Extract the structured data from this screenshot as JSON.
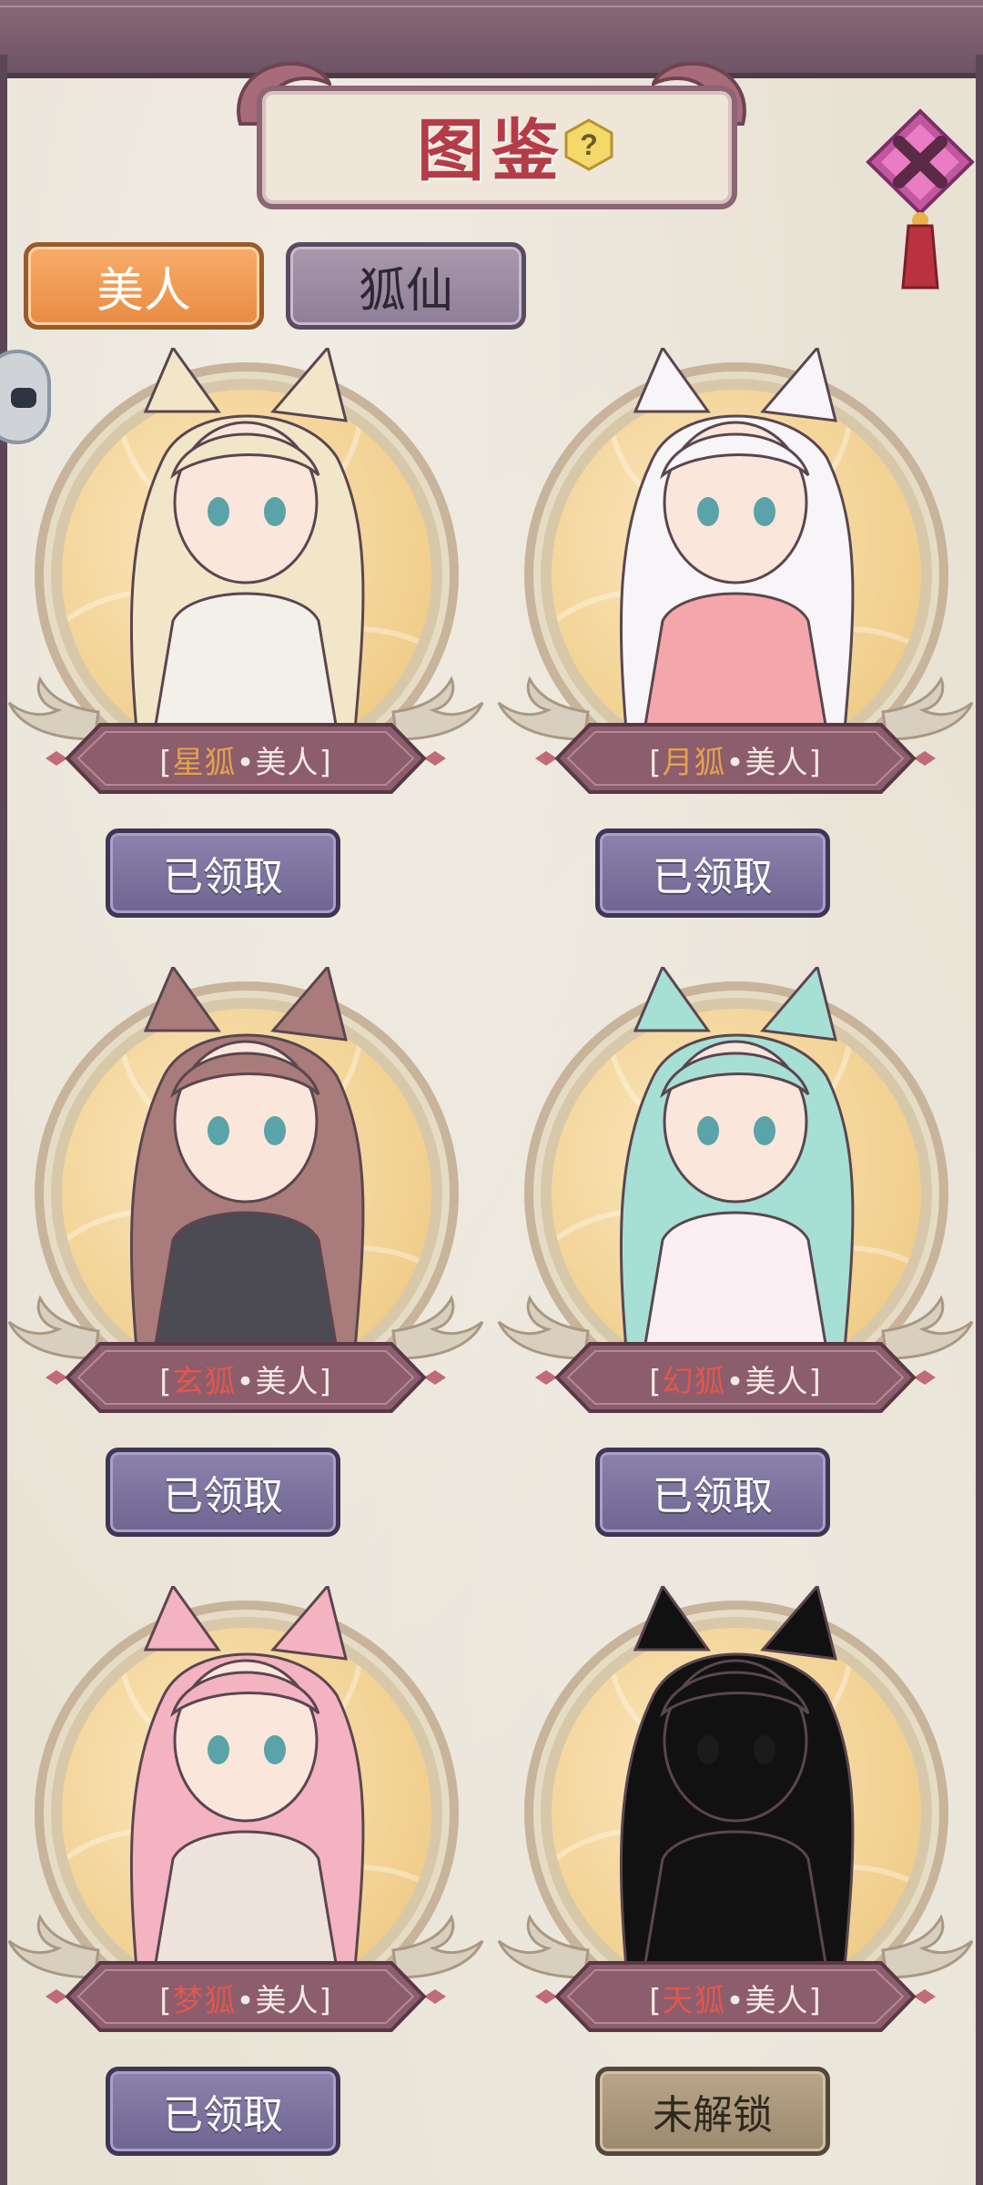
{
  "title": "图鉴",
  "help_icon": "question-mark-icon",
  "close_icon": "knot-close-icon",
  "tabs": [
    {
      "label": "美人",
      "active": true
    },
    {
      "label": "狐仙",
      "active": false
    }
  ],
  "cards": [
    {
      "prefix": "[",
      "fox": "星狐",
      "sep": "•",
      "suffix": "美人]",
      "button": "已领取",
      "state": "claimed",
      "hair": "#f2e6c9",
      "outfit": "#f3f0ea"
    },
    {
      "prefix": "[",
      "fox": "月狐",
      "sep": "•",
      "suffix": "美人]",
      "button": "已领取",
      "state": "claimed",
      "hair": "#f7f5f7",
      "outfit": "#f4a7aa"
    },
    {
      "prefix": "[",
      "fox": "玄狐",
      "sep": "•",
      "suffix": "美人]",
      "button": "已领取",
      "state": "claimed",
      "hair": "#a97c7b",
      "outfit": "#4c4a52"
    },
    {
      "prefix": "[",
      "fox": "幻狐",
      "sep": "•",
      "suffix": "美人]",
      "button": "已领取",
      "state": "claimed",
      "hair": "#a6e0d4",
      "outfit": "#fbeff3"
    },
    {
      "prefix": "[",
      "fox": "梦狐",
      "sep": "•",
      "suffix": "美人]",
      "button": "已领取",
      "state": "claimed",
      "hair": "#f4b3c1",
      "outfit": "#ede3da"
    },
    {
      "prefix": "[",
      "fox": "天狐",
      "sep": "•",
      "suffix": "美人]",
      "button": "未解锁",
      "state": "locked",
      "hair": "#111111",
      "outfit": "#111111"
    }
  ],
  "colors": {
    "accent_orange": "#f1a05b",
    "button_purple": "#7b709e",
    "button_locked": "#a89678",
    "fox_name_gold": "#e3a14d",
    "fox_name_red": "#e0574d"
  }
}
